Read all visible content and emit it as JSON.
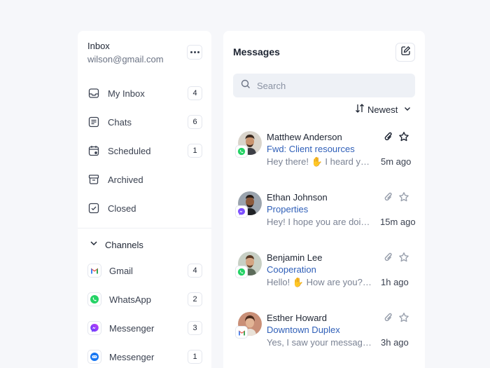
{
  "account": {
    "title": "Inbox",
    "email": "wilson@gmail.com"
  },
  "nav": [
    {
      "label": "My Inbox",
      "count": "4",
      "icon": "inbox-icon"
    },
    {
      "label": "Chats",
      "count": "6",
      "icon": "chat-icon"
    },
    {
      "label": "Scheduled",
      "count": "1",
      "icon": "calendar-icon"
    },
    {
      "label": "Archived",
      "count": "",
      "icon": "archive-icon"
    },
    {
      "label": "Closed",
      "count": "",
      "icon": "check-square-icon"
    }
  ],
  "channels": {
    "title": "Channels",
    "items": [
      {
        "label": "Gmail",
        "count": "4",
        "icon": "gmail-icon"
      },
      {
        "label": "WhatsApp",
        "count": "2",
        "icon": "whatsapp-icon"
      },
      {
        "label": "Messenger",
        "count": "3",
        "icon": "messenger-icon"
      },
      {
        "label": "Messenger",
        "count": "1",
        "icon": "messenger-blue-icon"
      }
    ]
  },
  "messages_panel": {
    "title": "Messages",
    "search_placeholder": "Search",
    "sort_label": "Newest",
    "items": [
      {
        "name": "Matthew Anderson",
        "subject": "Fwd: Client resources",
        "preview": "Hey there! ✋ I heard you are...",
        "time": "5m ago",
        "channel": "whatsapp",
        "highlighted": true
      },
      {
        "name": "Ethan Johnson",
        "subject": "Properties",
        "preview": "Hey! I hope you are doing well...",
        "time": "15m ago",
        "channel": "messenger",
        "highlighted": false
      },
      {
        "name": "Benjamin Lee",
        "subject": "Cooperation",
        "preview": "Hello! ✋ How are you? I wanted...",
        "time": "1h ago",
        "channel": "whatsapp",
        "highlighted": false
      },
      {
        "name": "Esther Howard",
        "subject": "Downtown Duplex",
        "preview": "Yes, I saw your message about...",
        "time": "3h ago",
        "channel": "gmail",
        "highlighted": false
      }
    ]
  },
  "colors": {
    "accent": "#2f5fb8",
    "whatsapp": "#25d366",
    "messenger": "#7b4dff",
    "background": "#f6f7fa"
  }
}
